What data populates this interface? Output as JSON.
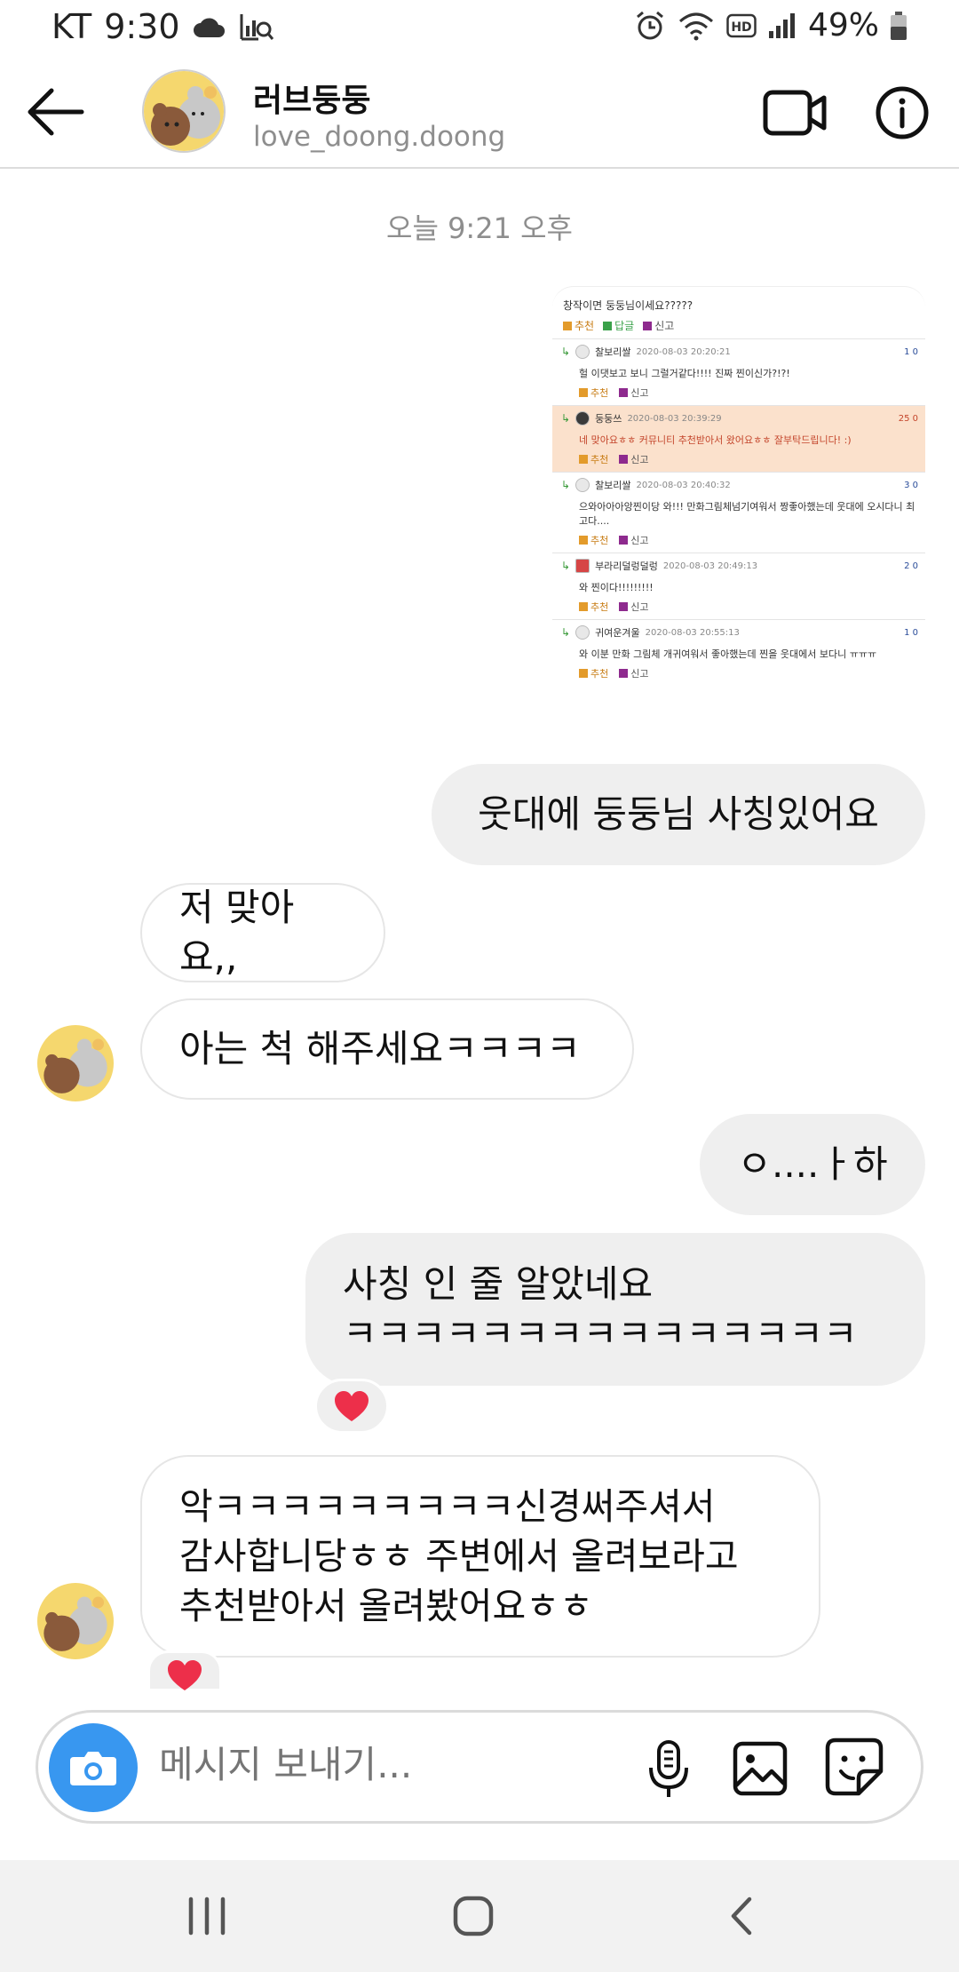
{
  "status_bar": {
    "carrier": "KT",
    "time": "9:30",
    "battery": "49%",
    "icons": [
      "cloud-icon",
      "data-search-icon",
      "alarm-icon",
      "wifi-icon",
      "hd-icon",
      "signal-icon",
      "battery-icon"
    ]
  },
  "header": {
    "name": "러브둥둥",
    "username": "love_doong.doong",
    "icons": [
      "back-arrow-icon",
      "video-call-icon",
      "info-icon"
    ]
  },
  "chat": {
    "timestamp": "오늘 9:21 오후",
    "shared_screenshot": {
      "topline": "창작이면 둥둥님이세요?????",
      "actions": [
        "추천",
        "답글",
        "신고"
      ],
      "comments": [
        {
          "nick": "찰보리쌀",
          "date": "2020-08-03 20:20:21",
          "score": "1 0",
          "body": "헐 이댓보고 보니 그럴거같다!!!! 진짜 찐이신가?!?!",
          "highlight": false
        },
        {
          "nick": "둥둥쓰",
          "date": "2020-08-03 20:39:29",
          "score": "25 0",
          "body": "네 맞아요ㅎㅎ 커뮤니티 추천받아서 왔어요ㅎㅎ 잘부탁드립니다! :)",
          "highlight": true
        },
        {
          "nick": "찰보리쌀",
          "date": "2020-08-03 20:40:32",
          "score": "3 0",
          "body": "으와아아아앙찐이당 와!!! 만화그림체넘기여워서 짱좋아했는데 웃대에 오시다니 최고다....",
          "highlight": false
        },
        {
          "nick": "부라리덜렁덜렁",
          "date": "2020-08-03 20:49:13",
          "score": "2 0",
          "body": "와 찐이다!!!!!!!!!",
          "highlight": false
        },
        {
          "nick": "귀여운겨울",
          "date": "2020-08-03 20:55:13",
          "score": "1 0",
          "body": "와 이분 만화 그림체 개귀여워서 좋아했는데 찐을 웃대에서 보다니 ㅠㅠㅠ",
          "highlight": false
        }
      ],
      "comment_actions": [
        "추천",
        "신고"
      ]
    },
    "messages": [
      {
        "side": "out",
        "text": "웃대에 둥둥님 사칭있어요"
      },
      {
        "side": "in",
        "text": "저 맞아요,,"
      },
      {
        "side": "in",
        "text": "아는 척 해주세요ㅋㅋㅋㅋ"
      },
      {
        "side": "out",
        "text": "ㅇ....ㅏ하"
      },
      {
        "side": "out",
        "line1": "사칭 인 줄 알았네요",
        "line2": "ㅋㅋㅋㅋㅋㅋㅋㅋㅋㅋㅋㅋㅋㅋㅋ"
      },
      {
        "side": "in",
        "line1": "악ㅋㅋㅋㅋㅋㅋㅋㅋㅋ신경써주셔서",
        "line2": "감사합니당ㅎㅎ 주변에서 올려보라고",
        "line3": "추천받아서 올려봤어요ㅎㅎ"
      }
    ],
    "reaction": "❤"
  },
  "composer": {
    "placeholder": "메시지 보내기...",
    "icons": [
      "camera-icon",
      "microphone-icon",
      "gallery-icon",
      "sticker-icon"
    ]
  },
  "colors": {
    "accent_blue": "#3897f0",
    "bubble_gray": "#efefef",
    "highlight_row": "#fbe1cc",
    "heart": "#ed2f4a"
  }
}
